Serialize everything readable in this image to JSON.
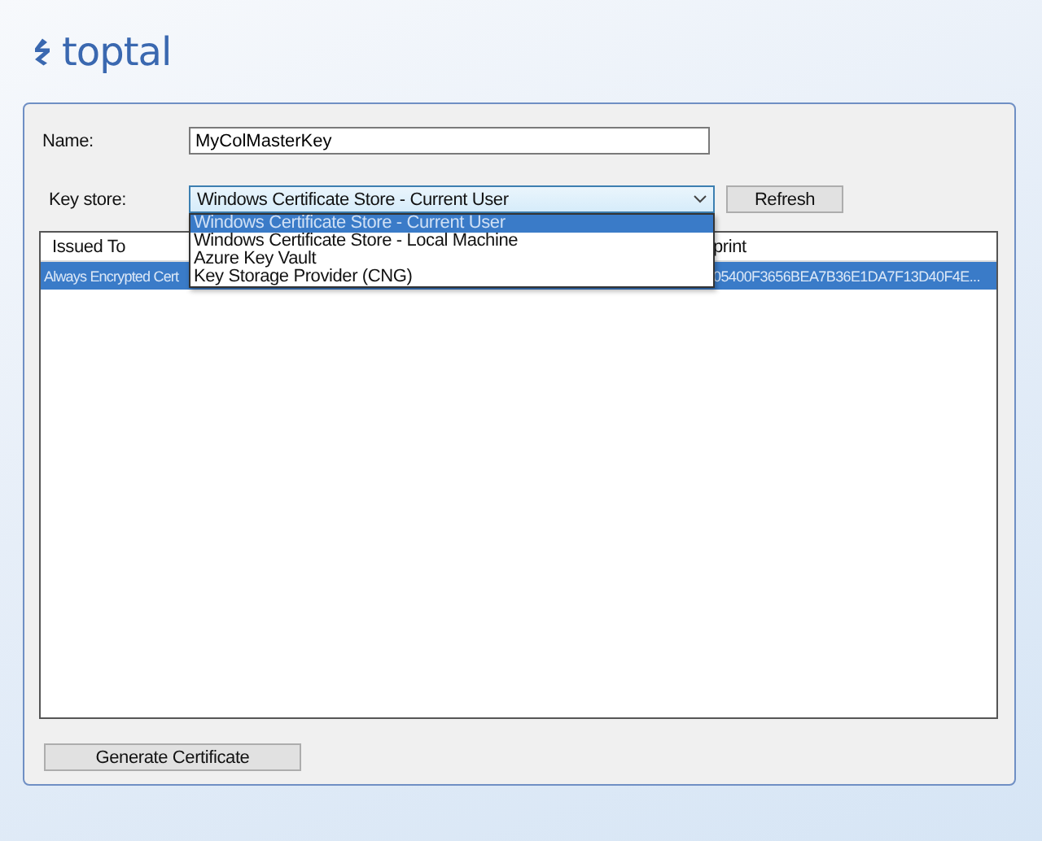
{
  "brand": {
    "name": "toptal"
  },
  "form": {
    "name_label": "Name:",
    "name_value": "MyColMasterKey",
    "key_store_label": "Key store:",
    "key_store_value": "Windows Certificate Store - Current User",
    "refresh_button": "Refresh"
  },
  "dropdown": {
    "expanded": true,
    "options": [
      {
        "label": "Windows Certificate Store - Current User",
        "selected": true
      },
      {
        "label": "Windows Certificate Store - Local Machine",
        "selected": false
      },
      {
        "label": "Azure Key Vault",
        "selected": false
      },
      {
        "label": "Key Storage Provider (CNG)",
        "selected": false
      }
    ]
  },
  "table": {
    "columns": [
      "Issued To",
      "print"
    ],
    "rows": [
      {
        "cells": [
          "Always Encrypted Cert",
          "05400F3656BEA7B36E1DA7F13D40F4E..."
        ],
        "selected": true
      }
    ]
  },
  "generate_button": "Generate Certificate"
}
